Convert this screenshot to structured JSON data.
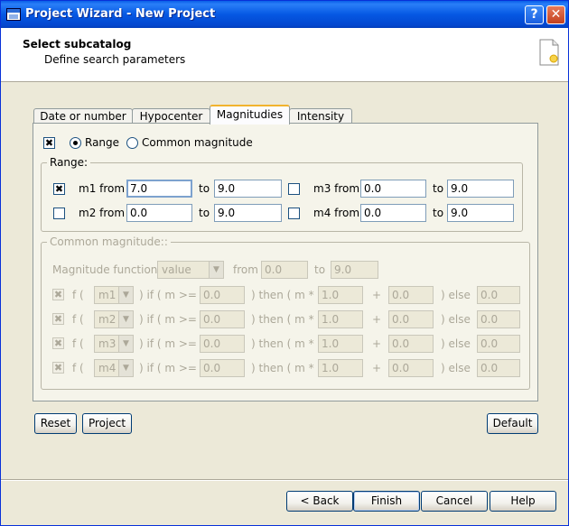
{
  "window": {
    "title": "Project Wizard - New Project",
    "help_glyph": "?",
    "close_glyph": "✕"
  },
  "header": {
    "title": "Select subcatalog",
    "subtitle": "Define search parameters"
  },
  "tabs": [
    "Date or number",
    "Hypocenter",
    "Magnitudies",
    "Intensity"
  ],
  "active_tab": "Magnitudies",
  "mode": {
    "enabled_check": "✖",
    "range_label": "Range",
    "common_label": "Common magnitude",
    "selected": "Range"
  },
  "range": {
    "label": "Range:",
    "to_label": "to",
    "rows": [
      {
        "checked": true,
        "check_glyph": "✖",
        "label": "m1 from",
        "from": "7.0",
        "to": "9.0"
      },
      {
        "checked": false,
        "check_glyph": "",
        "label": "m2 from",
        "from": "0.0",
        "to": "9.0"
      },
      {
        "checked": false,
        "check_glyph": "",
        "label": "m3 from",
        "from": "0.0",
        "to": "9.0"
      },
      {
        "checked": false,
        "check_glyph": "",
        "label": "m4 from",
        "from": "0.0",
        "to": "9.0"
      }
    ]
  },
  "common": {
    "label": "Common magnitude::",
    "function_label": "Magnitude function:",
    "function_value": "value",
    "from_label": "from",
    "from_value": "0.0",
    "to_label": "to",
    "to_value": "9.0",
    "f_label": "f (",
    "if_label": ") if ( m >=",
    "then_label": ") then ( m *",
    "plus_label": "+",
    "else_label": ") else",
    "rows": [
      {
        "check_glyph": "✖",
        "var": "m1",
        "threshold": "0.0",
        "mult": "1.0",
        "add": "0.0",
        "else": "0.0"
      },
      {
        "check_glyph": "✖",
        "var": "m2",
        "threshold": "0.0",
        "mult": "1.0",
        "add": "0.0",
        "else": "0.0"
      },
      {
        "check_glyph": "✖",
        "var": "m3",
        "threshold": "0.0",
        "mult": "1.0",
        "add": "0.0",
        "else": "0.0"
      },
      {
        "check_glyph": "✖",
        "var": "m4",
        "threshold": "0.0",
        "mult": "1.0",
        "add": "0.0",
        "else": "0.0"
      }
    ]
  },
  "buttons": {
    "reset": "Reset",
    "project": "Project",
    "default": "Default",
    "back": "< Back",
    "finish": "Finish",
    "cancel": "Cancel",
    "help": "Help"
  },
  "icons": {
    "app": "app-window-icon",
    "doc": "new-document-icon",
    "dropdown": "▼"
  }
}
